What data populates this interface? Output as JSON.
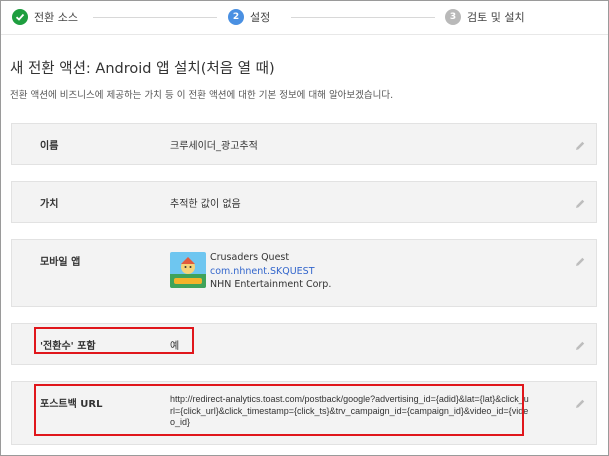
{
  "stepper": {
    "steps": [
      {
        "number": "✓",
        "label": "전환 소스",
        "state": "done"
      },
      {
        "number": "2",
        "label": "설정",
        "state": "current"
      },
      {
        "number": "3",
        "label": "검토 및 설치",
        "state": "pending"
      }
    ],
    "colors": {
      "done": "#1e9e3f",
      "current": "#4a90e2",
      "pending": "#b9b9b9"
    }
  },
  "header": {
    "title": "새 전환 액션: Android 앱 설치(처음 열 때)",
    "description": "전환 액션에 비즈니스에 제공하는 가치 등 이 전환 액션에 대한 기본 정보에 대해 알아보겠습니다."
  },
  "settings": {
    "name": {
      "label": "이름",
      "value": "크루세이더_광고추적"
    },
    "value": {
      "label": "가치",
      "value": "추적한 값이 없음"
    },
    "mobile_app": {
      "label": "모바일 앱",
      "app_name": "Crusaders Quest",
      "package": "com.nhnent.SKQUEST",
      "developer": "NHN Entertainment Corp."
    },
    "include_in_conversions": {
      "label": "'전환수' 포함",
      "value": "예"
    },
    "postback_url": {
      "label": "포스트백 URL",
      "value": "http://redirect-analytics.toast.com/postback/google?advertising_id={adid}&lat={lat}&click_url={click_url}&click_timestamp={click_ts}&trv_campaign_id={campaign_id}&video_id={video_id}"
    }
  },
  "highlight_color": "#e0161b"
}
